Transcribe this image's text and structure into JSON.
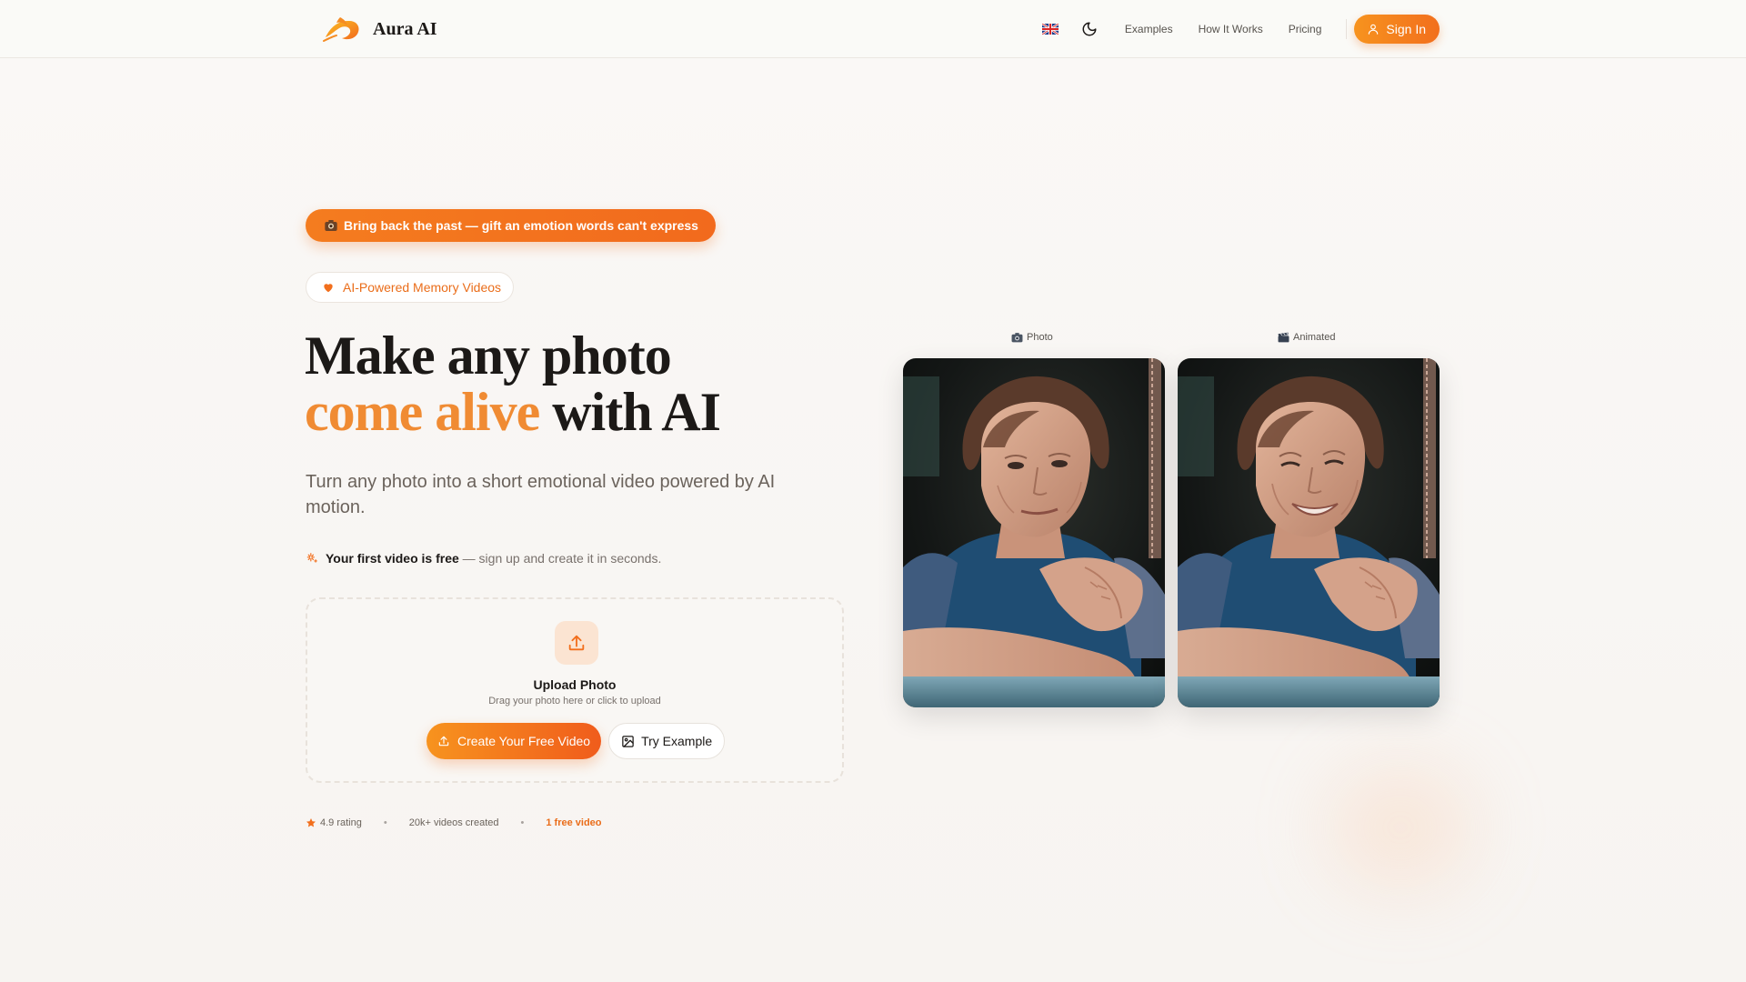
{
  "nav": {
    "brand": "Aura AI",
    "language_icon": "uk-flag-icon",
    "theme_icon": "moon-icon",
    "links": [
      "Examples",
      "How It Works",
      "Pricing"
    ],
    "sign_in": "Sign In"
  },
  "hero": {
    "promo_badge": "Bring back the past — gift an emotion words can't express",
    "promo_icon": "camera-icon",
    "chip": "AI-Powered Memory Videos",
    "headline_line1": "Make any photo",
    "headline_accent": "come alive",
    "headline_rest": "with AI",
    "subtitle": "Turn any photo into a short emotional video powered by AI motion.",
    "free_strong": "Your first video is free",
    "free_rest": "— sign up and create it in seconds.",
    "upload": {
      "title": "Upload Photo",
      "hint": "Drag your photo here or click to upload",
      "primary_button": "Create Your Free Video",
      "secondary_button": "Try Example"
    },
    "stats": {
      "rating": "4.9 rating",
      "videos": "20k+ videos created",
      "free": "1 free video"
    }
  },
  "preview": {
    "photo_caption": "Photo",
    "animated_caption": "Animated",
    "photo_caption_icon": "camera-icon",
    "animated_caption_icon": "clapperboard-icon"
  },
  "colors": {
    "accent": "#f26f1d",
    "accent_light": "#f08b33",
    "background": "#f8f6f3",
    "text": "#1c1917"
  }
}
